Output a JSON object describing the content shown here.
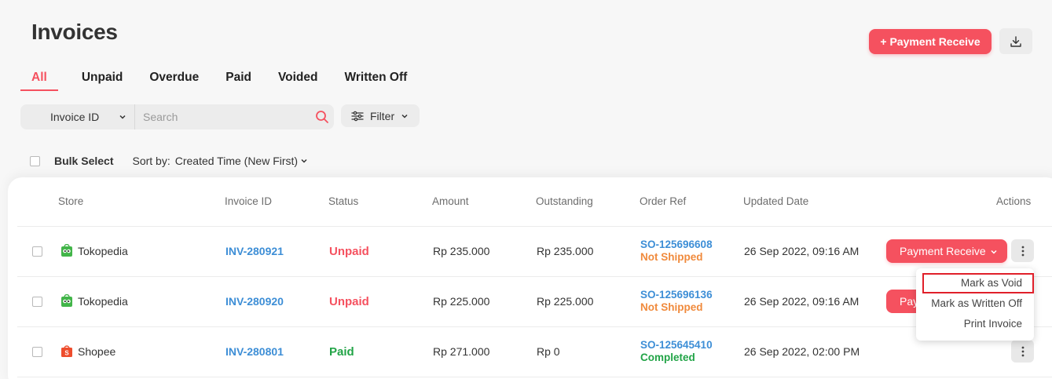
{
  "header": {
    "title": "Invoices",
    "payment_receive_label": "+ Payment Receive"
  },
  "tabs": [
    {
      "label": "All",
      "active": true
    },
    {
      "label": "Unpaid"
    },
    {
      "label": "Overdue"
    },
    {
      "label": "Paid"
    },
    {
      "label": "Voided"
    },
    {
      "label": "Written Off"
    }
  ],
  "search": {
    "type_label": "Invoice ID",
    "placeholder": "Search",
    "value": ""
  },
  "filter_label": "Filter",
  "toolbar": {
    "bulk_select_label": "Bulk Select",
    "sort_label": "Sort by:",
    "sort_value": "Created Time (New First)"
  },
  "table": {
    "columns": [
      "Store",
      "Invoice ID",
      "Status",
      "Amount",
      "Outstanding",
      "Order Ref",
      "Updated Date",
      "Actions"
    ],
    "rows": [
      {
        "store": "Tokopedia",
        "invoice_id": "INV-280921",
        "status": "Unpaid",
        "amount": "Rp 235.000",
        "outstanding": "Rp 235.000",
        "order_ref": "SO-125696608",
        "order_status": "Not Shipped",
        "updated": "26 Sep 2022, 09:16 AM",
        "action_label": "Payment Receive"
      },
      {
        "store": "Tokopedia",
        "invoice_id": "INV-280920",
        "status": "Unpaid",
        "amount": "Rp 225.000",
        "outstanding": "Rp 225.000",
        "order_ref": "SO-125696136",
        "order_status": "Not Shipped",
        "updated": "26 Sep 2022, 09:16 AM",
        "action_label": "Pay"
      },
      {
        "store": "Shopee",
        "invoice_id": "INV-280801",
        "status": "Paid",
        "amount": "Rp 271.000",
        "outstanding": "Rp 0",
        "order_ref": "SO-125645410",
        "order_status": "Completed",
        "updated": "26 Sep 2022, 02:00 PM"
      }
    ]
  },
  "dropdown": {
    "items": [
      "Mark as Void",
      "Mark as Written Off",
      "Print Invoice"
    ]
  },
  "colors": {
    "accent": "#f5515f",
    "link": "#3d8ed6",
    "paid": "#22a447",
    "not_shipped": "#f08a3c"
  },
  "icons": {
    "download": "download-icon",
    "search": "search-icon",
    "filter": "sliders-icon",
    "more": "kebab-menu-icon",
    "tokopedia": "tokopedia-logo-icon",
    "shopee": "shopee-logo-icon"
  }
}
